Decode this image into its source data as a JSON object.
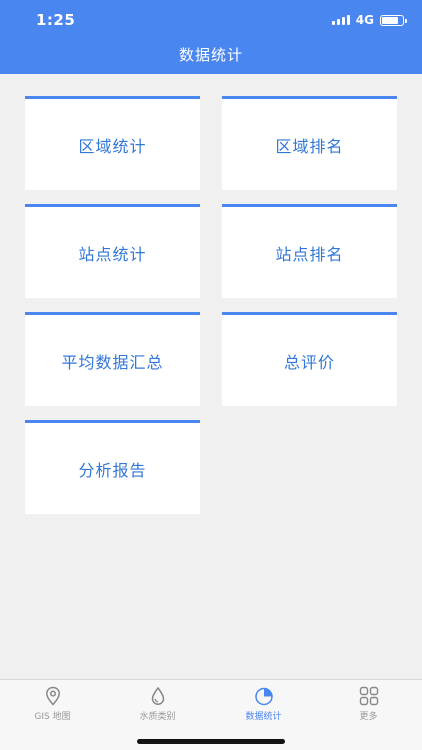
{
  "status_bar": {
    "time": "1:25",
    "network": "4G"
  },
  "header": {
    "title": "数据统计"
  },
  "cards": [
    {
      "label": "区域统计"
    },
    {
      "label": "区域排名"
    },
    {
      "label": "站点统计"
    },
    {
      "label": "站点排名"
    },
    {
      "label": "平均数据汇总"
    },
    {
      "label": "总评价"
    },
    {
      "label": "分析报告"
    }
  ],
  "tabbar": {
    "items": [
      {
        "label": "GIS 地图",
        "icon": "map-pin-icon"
      },
      {
        "label": "水质类别",
        "icon": "water-drop-icon"
      },
      {
        "label": "数据统计",
        "icon": "pie-chart-icon",
        "active": true
      },
      {
        "label": "更多",
        "icon": "grid-icon"
      }
    ]
  },
  "colors": {
    "accent": "#4a86f0",
    "card_text": "#3277d8",
    "background": "#f0f0f0"
  }
}
